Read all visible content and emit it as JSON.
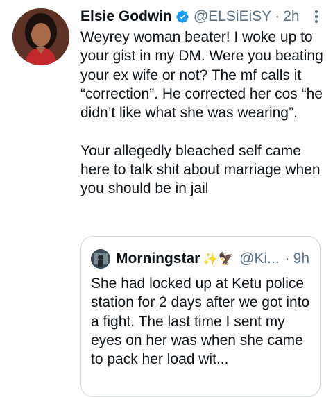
{
  "tweet": {
    "author_name": "Elsie Godwin",
    "handle": "@ELSiEiSY",
    "separator": "·",
    "time": "2h",
    "verified": true,
    "paragraphs": [
      "Weyrey woman beater! I woke up to your gist in my DM. Were you beating your ex wife or not? The mf calls it “correction”. He corrected her cos “he didn’t like what she was wearing”.",
      "Your allegedly bleached self came here to talk shit about marriage when you should be in jail"
    ]
  },
  "quoted_tweet": {
    "author_name": "Morningstar",
    "emojis": "✨🦅",
    "handle": "@Ki...",
    "separator": "·",
    "time": "9h",
    "text": "She had locked up at Ketu police station for 2 days after we got into a fight. The last time I sent my eyes on her was when she came to pack her load wit..."
  },
  "colors": {
    "text": "#0f1419",
    "secondary": "#5b7083",
    "verified_badge": "#1d9bf0",
    "border": "#cfd9de"
  },
  "icons": {
    "verified": "verified-badge-icon",
    "more": "more-options-icon"
  }
}
